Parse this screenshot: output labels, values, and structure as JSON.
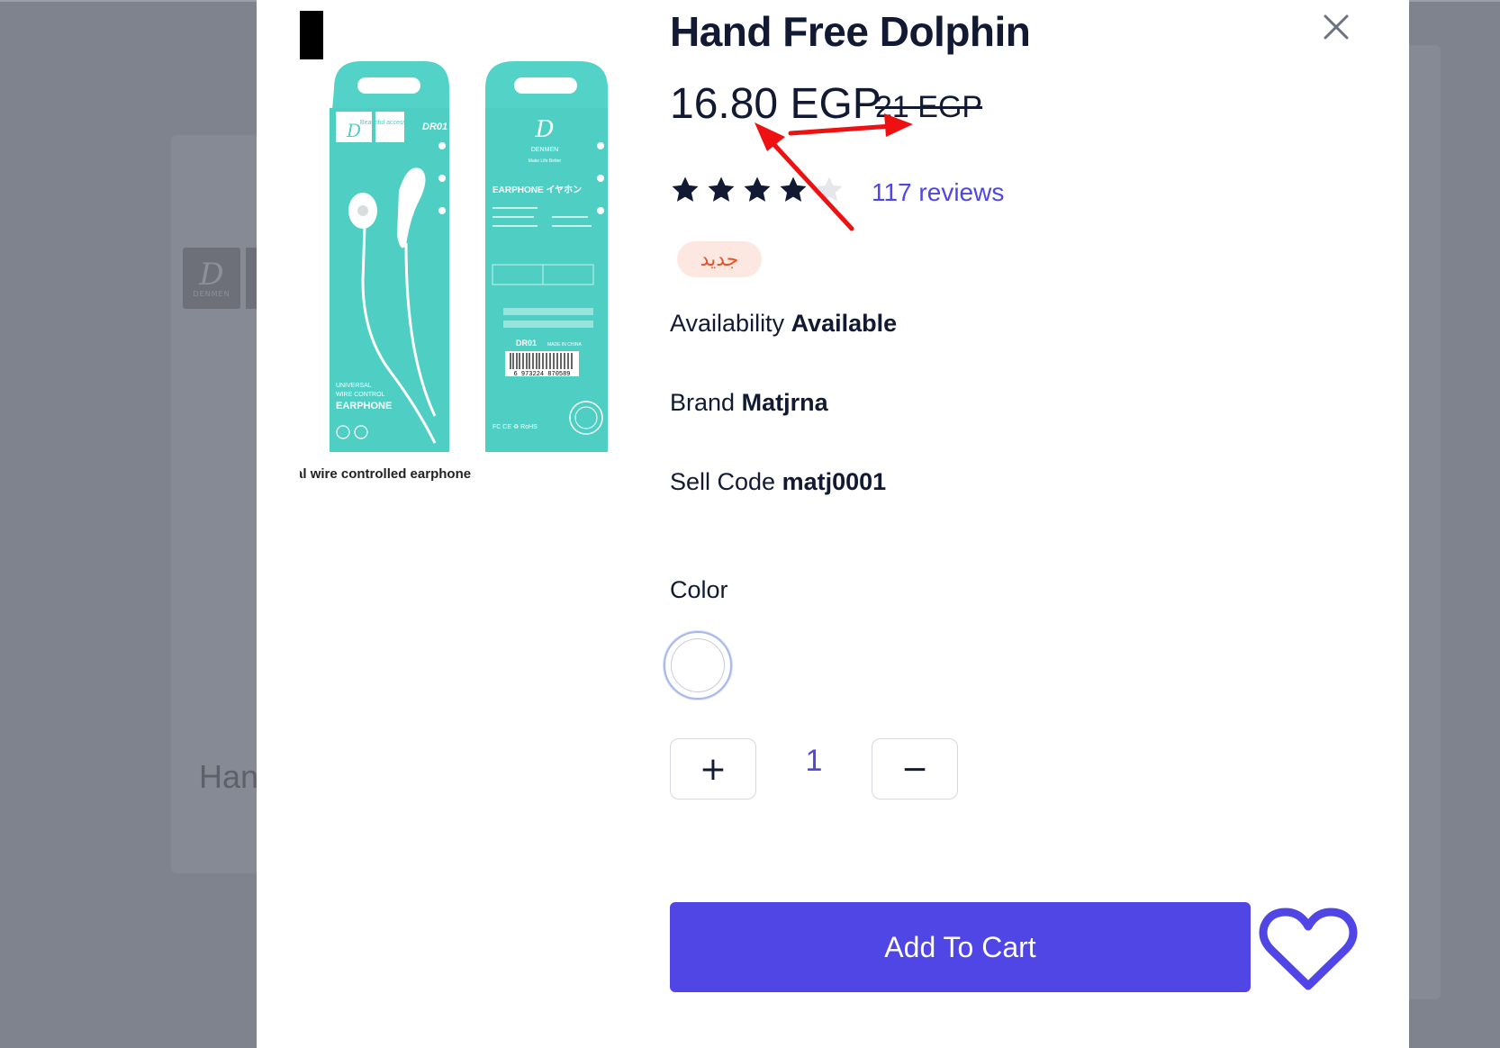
{
  "background": {
    "title_fragment": "Han",
    "thumb_logo_letter": "D",
    "thumb_logo_text": "DENMEN"
  },
  "modal": {
    "close_icon": "close-icon",
    "image": {
      "caption": "Universal wire controlled earphone",
      "pack_front": {
        "brand_letter": "D",
        "brand_name": "DENMEN",
        "tag": "Beautiful accessories",
        "model": "DR01",
        "line1": "UNIVERSAL",
        "line2": "WIRE CONTROL",
        "line3": "EARPHONE",
        "side_label": "Beautiful accessories"
      },
      "pack_back": {
        "brand_letter": "D",
        "brand_name": "DENMEN",
        "slogan": "Make Life Better",
        "heading": "EARPHONE イヤホン",
        "model": "DR01",
        "made_in": "MADE IN CHINA",
        "barcode": "6 973224 870589",
        "certs": "FC CE ♻ RoHS"
      }
    },
    "title": "Hand Free Dolphin",
    "price": "16.80 EGP",
    "old_price": "21 EGP",
    "rating": {
      "value": 4,
      "max": 5
    },
    "reviews_label": "117 reviews",
    "badge": "جديد",
    "specs": {
      "availability_label": "Availability",
      "availability_value": "Available",
      "brand_label": "Brand",
      "brand_value": "Matjrna",
      "code_label": "Sell Code",
      "code_value": "matj0001"
    },
    "color_label": "Color",
    "colors": [
      {
        "name": "white",
        "hex": "#ffffff",
        "selected": true
      }
    ],
    "quantity": {
      "value": "1",
      "plus_label": "+",
      "minus_label": "−"
    },
    "add_to_cart_label": "Add To Cart",
    "wishlist_icon": "heart-icon"
  },
  "theme": {
    "accent": "#4f46e5",
    "text": "#121a33",
    "badge_bg": "#fde8e1",
    "badge_text": "#e8522b",
    "pack_teal": "#4fd1c5",
    "overlay": "#7f838d",
    "annotation_arrow": "#ee1111"
  }
}
